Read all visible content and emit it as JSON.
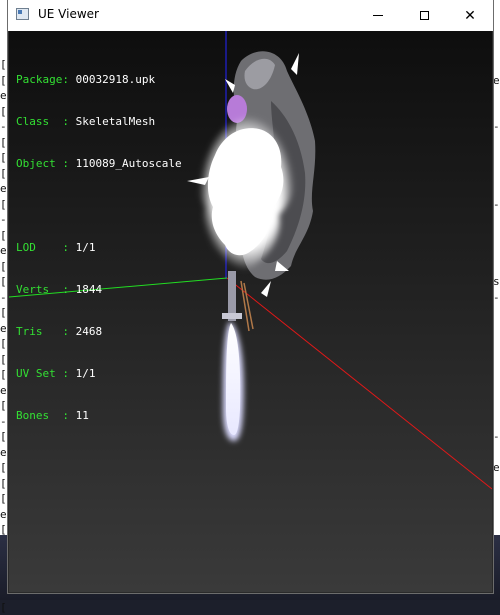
{
  "window": {
    "title": "UE Viewer",
    "app_icon": "app-window-icon",
    "controls": {
      "minimize_icon": "minimize-icon",
      "maximize_icon": "maximize-icon",
      "close_icon": "close-icon",
      "close_glyph": "✕"
    }
  },
  "info": {
    "package_key": "Package:",
    "package_value": "00032918.upk",
    "class_key": "Class  :",
    "class_value": "SkeletalMesh",
    "object_key": "Object :",
    "object_value": "110089_Autoscale",
    "lod_key": "LOD    :",
    "lod_value": "1/1",
    "verts_key": "Verts  :",
    "verts_value": "1844",
    "tris_key": "Tris   :",
    "tris_value": "2468",
    "uvset_key": "UV Set :",
    "uvset_value": "1/1",
    "bones_key": "Bones  :",
    "bones_value": "11"
  },
  "background": {
    "left_glyphs": "[\n[\ne\n[\n-\n[\n[\n[\ne\n[\n-\n[\ne\n[\n[\n-\n[\ne\n[\n[\n[\ne\n[\n-\n[\ne\n[\n[\n[\ne\n[\n-\n[\ne\n[\n[",
    "right_glyphs": "\ne\n\n\n-\n\n\n\n\n-\n\n\n\n\ns\n-\n\n\n\n\n\n\n\n\n-\n\ne",
    "taskbar_color": "#2b2f44"
  },
  "colors": {
    "label_green": "#33e033",
    "value_white": "#ffffff",
    "axis_x": "#ff2020",
    "axis_y": "#20e020",
    "axis_z": "#2020ff"
  }
}
